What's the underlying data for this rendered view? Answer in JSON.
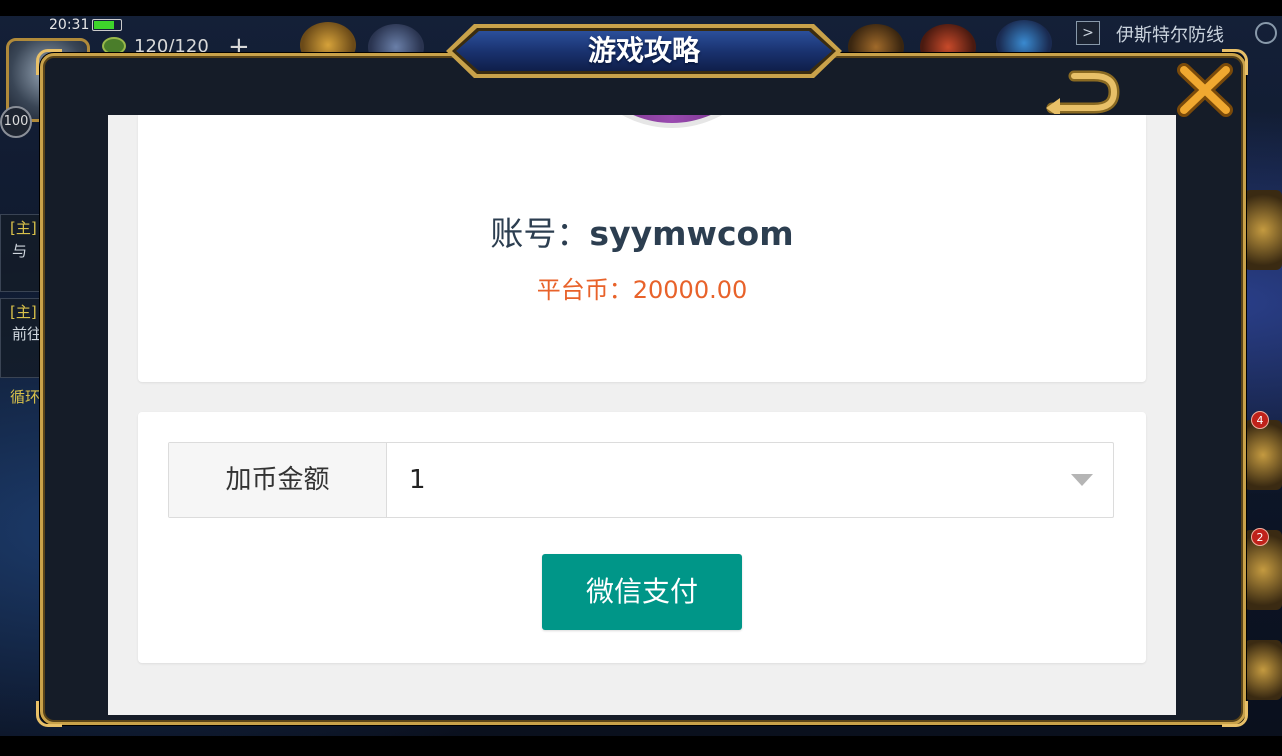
{
  "status_bar": {
    "time": "20:31",
    "battery_level": 0.75
  },
  "game_hud": {
    "level": "100",
    "stamina": "120/120",
    "plus_label": "+",
    "region_name": "伊斯特尔防线",
    "quests": [
      {
        "tag": "[主]",
        "subtitle": "与"
      },
      {
        "tag": "[主]",
        "subtitle": "前往"
      }
    ],
    "loop_tag": "循环",
    "notifications": [
      "4",
      "2"
    ]
  },
  "modal": {
    "title": "游戏攻略",
    "back_icon": "back-arrow-icon",
    "close_icon": "close-x-icon"
  },
  "profile": {
    "account_label": "账号：",
    "account_value": "syymwcom",
    "coins_label": "平台币：",
    "coins_value": "20000.00"
  },
  "payment": {
    "amount_label": "加币金额",
    "amount_value": "1",
    "pay_button_label": "微信支付"
  },
  "colors": {
    "accent_teal": "#009688",
    "coins_orange": "#e8622a",
    "frame_gold": "#c9a24a",
    "account_text": "#2c3e50"
  }
}
